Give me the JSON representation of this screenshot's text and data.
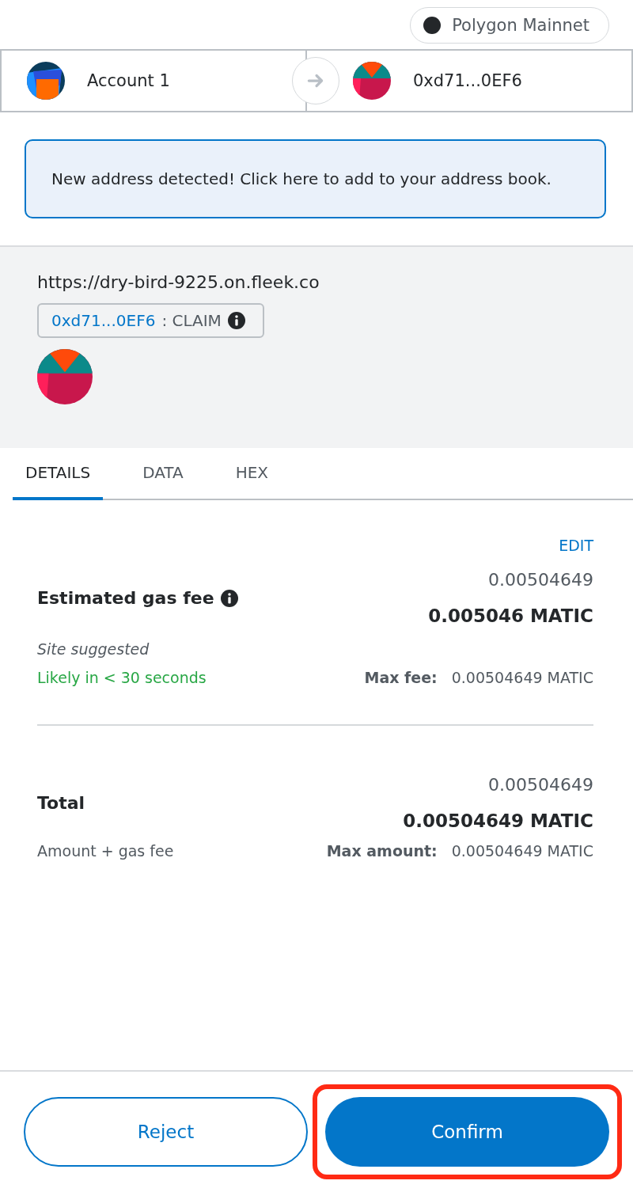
{
  "network": {
    "label": "Polygon Mainnet"
  },
  "sender": {
    "name": "Account 1"
  },
  "recipient": {
    "name": "0xd71...0EF6"
  },
  "alert": {
    "text": "New address detected! Click here to add to your address book."
  },
  "site": {
    "origin": "https://dry-bird-9225.on.fleek.co",
    "address": "0xd71...0EF6",
    "method": ": CLAIM"
  },
  "tabs": [
    {
      "label": "DETAILS",
      "selected": true
    },
    {
      "label": "DATA",
      "selected": false
    },
    {
      "label": "HEX",
      "selected": false
    }
  ],
  "edit": "EDIT",
  "gas": {
    "label": "Estimated gas fee",
    "secondary": "0.00504649",
    "primary": "0.005046 MATIC",
    "note": "Site suggested",
    "timing": "Likely in < 30 seconds",
    "max_label": "Max fee:",
    "max_value": "0.00504649 MATIC"
  },
  "total": {
    "label": "Total",
    "secondary": "0.00504649",
    "primary": "0.00504649 MATIC",
    "note": "Amount + gas fee",
    "max_label": "Max amount:",
    "max_value": "0.00504649 MATIC"
  },
  "buttons": [
    {
      "label": "Reject",
      "kind": "secondary",
      "highlighted": false
    },
    {
      "label": "Confirm",
      "kind": "primary",
      "highlighted": true
    }
  ]
}
